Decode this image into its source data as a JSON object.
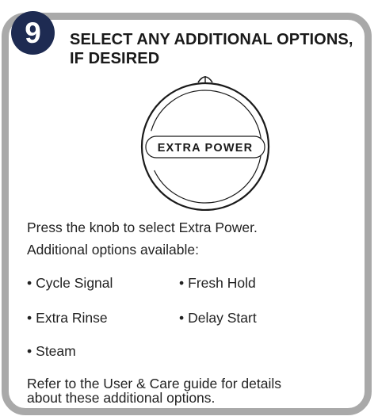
{
  "step": {
    "number": "9",
    "title_line1": "SELECT ANY ADDITIONAL OPTIONS,",
    "title_line2": "IF DESIRED"
  },
  "knob": {
    "label": "EXTRA POWER"
  },
  "instructions": {
    "line1": "Press the knob to select Extra Power.",
    "line2": "Additional options available:"
  },
  "options": [
    "Cycle Signal",
    "Fresh Hold",
    "Extra Rinse",
    "Delay Start",
    "Steam"
  ],
  "bullet_char": "•",
  "footer": {
    "line1": "Refer to the User & Care guide for details",
    "line2": "about these additional options."
  },
  "colors": {
    "badge": "#1e2b52",
    "border": "#a9a9a9",
    "text": "#1a1a1a"
  }
}
